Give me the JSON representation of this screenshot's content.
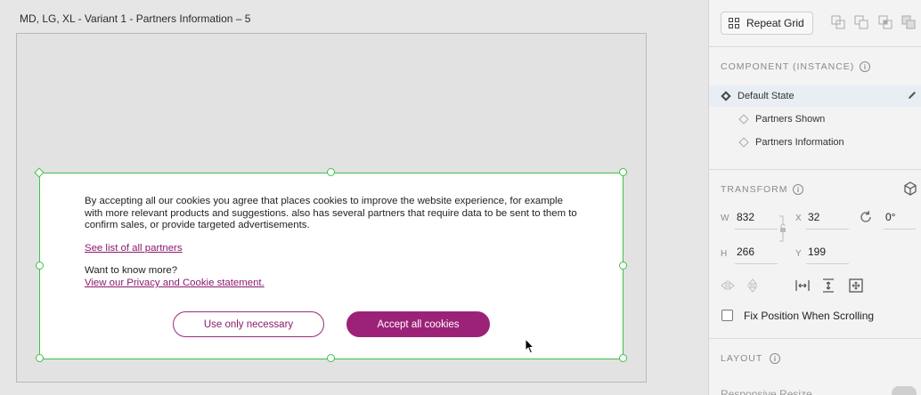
{
  "canvas": {
    "artboard_title": "MD, LG, XL - Variant 1 - Partners Information – 5",
    "cookie": {
      "text": "By accepting all our cookies you agree that places cookies to improve the website experience, for example with more relevant products and suggestions. also has several partners that require data to be sent to them to confirm sales, or provide targeted advertisements.",
      "partners_link": "See list of all partners",
      "know_more": "Want to know more?",
      "privacy_link": "View our Privacy and Cookie statement.",
      "btn_necessary": "Use only necessary",
      "btn_accept": "Accept all cookies"
    },
    "colors": {
      "brand": "#9c2278",
      "selection": "#3fc04a"
    }
  },
  "panel": {
    "repeat_grid": "Repeat Grid",
    "component_heading": "COMPONENT (INSTANCE)",
    "states": [
      "Default State",
      "Partners Shown",
      "Partners Information"
    ],
    "transform_heading": "TRANSFORM",
    "w_label": "W",
    "w_value": "832",
    "x_label": "X",
    "x_value": "32",
    "rotation": "0°",
    "h_label": "H",
    "h_value": "266",
    "y_label": "Y",
    "y_value": "199",
    "fix_position": "Fix Position When Scrolling",
    "layout_heading": "LAYOUT",
    "responsive_resize": "Responsive Resize"
  }
}
